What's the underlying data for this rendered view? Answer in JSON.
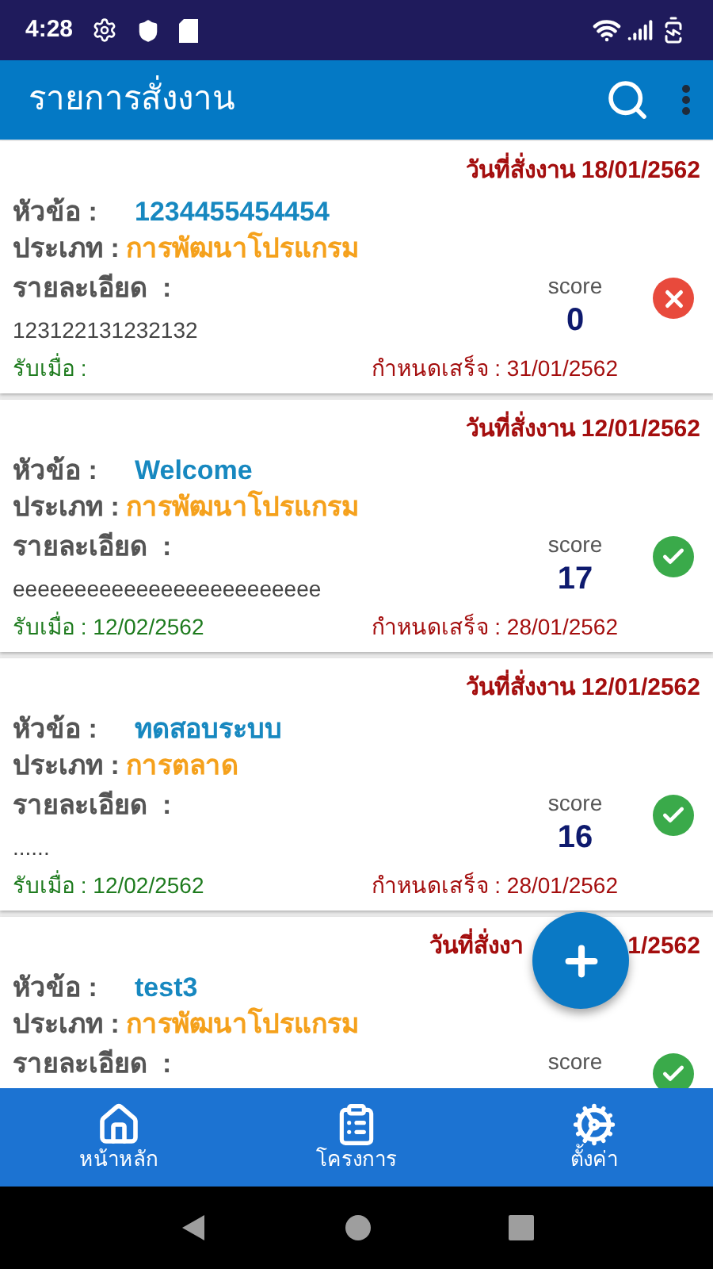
{
  "status_bar": {
    "time": "4:28"
  },
  "app_bar": {
    "title": "รายการสั่งงาน"
  },
  "jobs": [
    {
      "order_date": "วันที่สั่งงาน 18/01/2562",
      "title_label": "หัวข้อ :",
      "title": "1234455454454",
      "type_label": "ประเภท :",
      "type": "การพัฒนาโปรแกรม",
      "detail_label": "รายละเอียด  :",
      "detail": "123122131232132",
      "score_label": "score",
      "score": "0",
      "approved": false,
      "received": "รับเมื่อ :",
      "due": "กำหนดเสร็จ : 31/01/2562"
    },
    {
      "order_date": "วันที่สั่งงาน 12/01/2562",
      "title_label": "หัวข้อ :",
      "title": "Welcome",
      "type_label": "ประเภท :",
      "type": "การพัฒนาโปรแกรม",
      "detail_label": "รายละเอียด  :",
      "detail": "eeeeeeeeeeeeeeeeeeeeeeeee",
      "score_label": "score",
      "score": "17",
      "approved": true,
      "received": "รับเมื่อ : 12/02/2562",
      "due": "กำหนดเสร็จ : 28/01/2562"
    },
    {
      "order_date": "วันที่สั่งงาน 12/01/2562",
      "title_label": "หัวข้อ :",
      "title": "ทดสอบระบบ",
      "type_label": "ประเภท :",
      "type": "การตลาด",
      "detail_label": "รายละเอียด  :",
      "detail": "......",
      "score_label": "score",
      "score": "16",
      "approved": true,
      "received": "รับเมื่อ : 12/02/2562",
      "due": "กำหนดเสร็จ : 28/01/2562"
    },
    {
      "order_date_parts": [
        "วันที่สั่งงา",
        "1/2562"
      ],
      "title_label": "หัวข้อ :",
      "title": "test3",
      "type_label": "ประเภท :",
      "type": "การพัฒนาโปรแกรม",
      "detail_label": "รายละเอียด  :",
      "score_label": "score",
      "approved": true
    }
  ],
  "bottom_nav": [
    {
      "kind": "home",
      "label": "หน้าหลัก"
    },
    {
      "kind": "clipboard",
      "label": "โครงการ"
    },
    {
      "kind": "settings",
      "label": "ตั้งค่า"
    }
  ]
}
